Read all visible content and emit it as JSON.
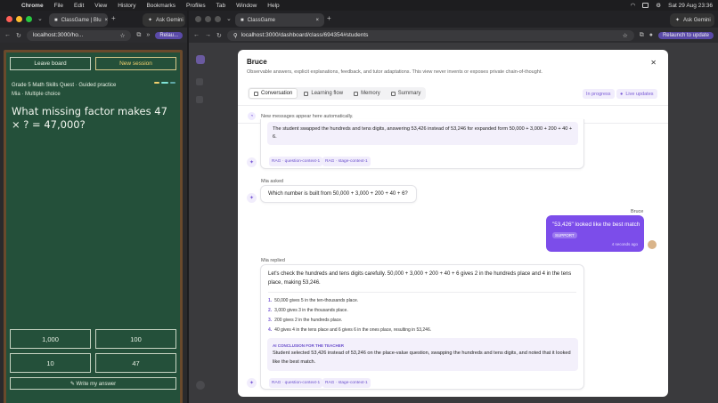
{
  "menubar": {
    "app": "Chrome",
    "items": [
      "File",
      "Edit",
      "View",
      "History",
      "Bookmarks",
      "Profiles",
      "Tab",
      "Window",
      "Help"
    ],
    "clock": "Sat 29 Aug  23:36"
  },
  "left_window": {
    "tab_title": "ClassGame | Blu",
    "ask_gemini": "Ask Gemini",
    "url": "localhost:3000/ho...",
    "relaunch": "Relau...",
    "board": {
      "leave_label": "Leave board",
      "new_session_label": "New session",
      "grade": "Grade 5 Math Skills Quest · Guided practice",
      "mode": "Mia · Multiple choice",
      "question": "What missing factor makes 47 × ? = 47,000?",
      "answers": [
        "1,000",
        "100",
        "10",
        "47"
      ],
      "write_label": "✎ Write my answer"
    }
  },
  "right_window": {
    "tab_title": "ClassGame",
    "ask_gemini": "Ask Gemini",
    "url": "localhost:3000/dashboard/class/694354#students",
    "relaunch": "Relaunch to update"
  },
  "modal": {
    "title": "Bruce",
    "subtitle": "Observable answers, explicit explanations, feedback, and tutor adaptations. This view never invents or exposes private chain-of-thought.",
    "tabs": [
      "Conversation",
      "Learning flow",
      "Memory",
      "Summary"
    ],
    "status": "In progress",
    "live": "Live updates",
    "note": "New messages appear here automatically.",
    "msg1_text": "The student swapped the hundreds and tens digits, answering 53,426 instead of 53,246 for expanded form 50,000 + 3,000 + 200 + 40 + 6.",
    "tags1": [
      "RAG · question-context-1",
      "RAG · stage-context-1"
    ],
    "mia_asked": "Mia asked",
    "question_text": "Which number is built from 50,000 + 3,000 + 200 + 40 + 6?",
    "user_name": "Bruce",
    "user_text": "\"53,426\" looked like the best match",
    "support_tag": "SUPPORT",
    "user_time": "4 seconds ago",
    "mia_replied": "Mia replied",
    "reply_text": "Let's check the hundreds and tens digits carefully. 50,000 + 3,000 + 200 + 40 + 6 gives 2 in the hundreds place and 4 in the tens place, making 53,246.",
    "steps": [
      "50,000 gives 5 in the ten-thousands place.",
      "3,000 gives 3 in the thousands place.",
      "200 gives 2 in the hundreds place.",
      "40 gives 4 in the tens place and 6 gives 6 in the ones place, resulting in 53,246."
    ],
    "step_nums": [
      "1.",
      "2.",
      "3.",
      "4."
    ],
    "conclusion_head": "AI CONCLUSION FOR THE TEACHER",
    "conclusion_text": "Student selected 53,426 instead of 53,246 on the place-value question, swapping the hundreds and tens digits, and noted that it looked like the best match.",
    "tags2": [
      "RAG · question-context-1",
      "RAG · stage-context-1"
    ]
  },
  "colors": {
    "accent": "#7c4dea",
    "board": "#24503a",
    "frame": "#6a4a2c"
  }
}
